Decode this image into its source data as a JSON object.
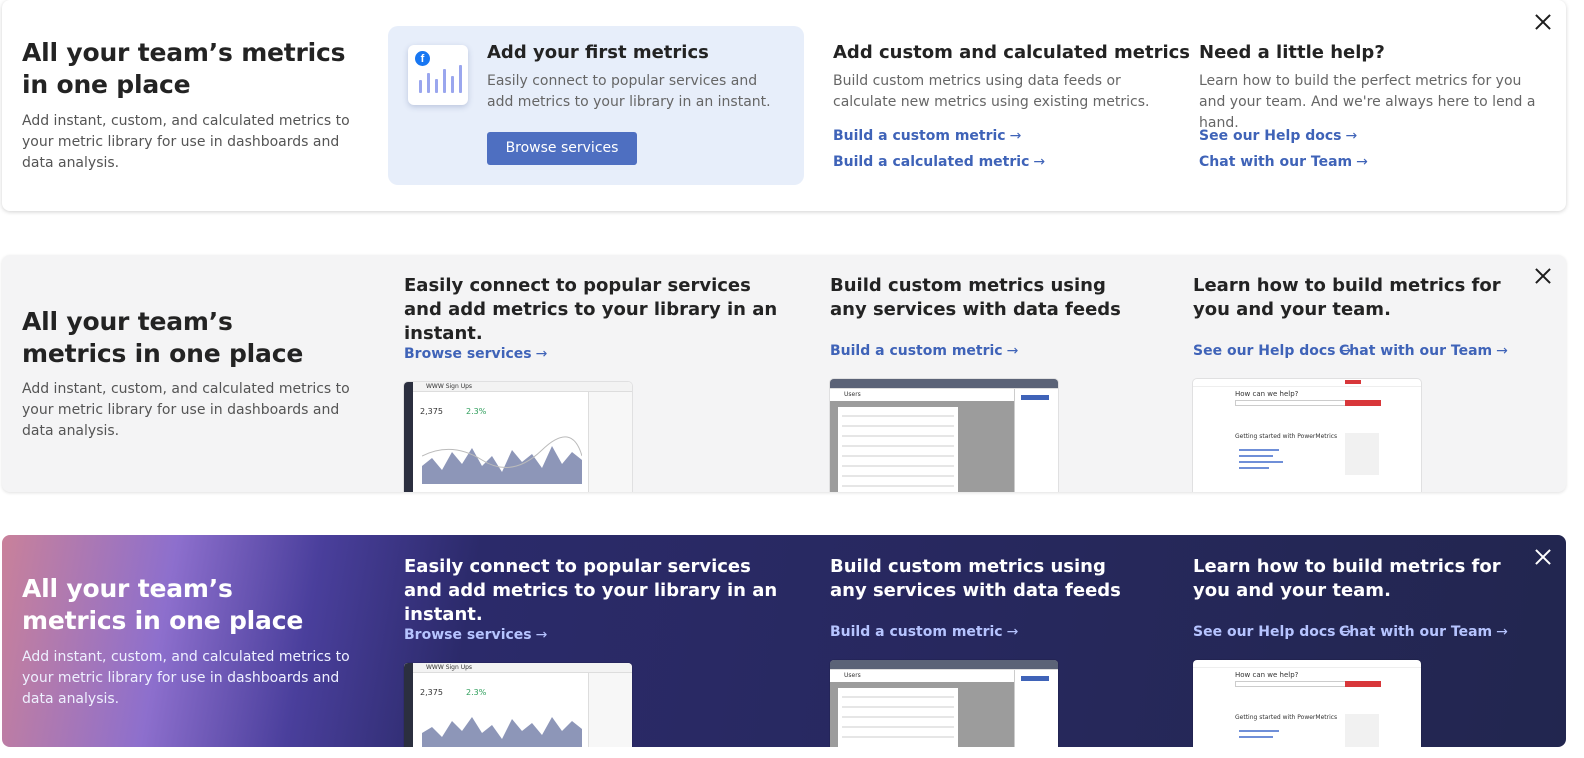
{
  "banner1": {
    "intro_title": "All your team’s metrics in one place",
    "intro_text": "Add instant, custom, and calculated metrics to your metric library for use in dashboards and data analysis.",
    "feature_title": "Add your first metrics",
    "feature_text": "Easily connect to popular services and add metrics to your library in an instant.",
    "feature_button": "Browse services",
    "custom_title": "Add custom and calculated metrics",
    "custom_text": "Build custom metrics using data feeds or calculate new metrics using existing metrics.",
    "custom_link1": "Build a custom metric",
    "custom_link2": "Build a calculated metric",
    "help_title": "Need a little help?",
    "help_text": "Learn how to build the perfect metrics for you and your team. And we're always here to lend a hand.",
    "help_link1": "See our Help docs",
    "help_link2": "Chat with our Team"
  },
  "banner2": {
    "intro_title": "All your team’s metrics in one place",
    "intro_text": "Add instant, custom, and calculated metrics to your metric library for use in dashboards and data analysis.",
    "col1_title": "Easily connect to popular services and add metrics to your library in an instant.",
    "col1_link": "Browse services",
    "col2_title": "Build custom metrics using any services with data feeds",
    "col2_link": "Build a custom metric",
    "col3_title": "Learn how to build metrics for you and your team.",
    "col3_link1": "See our Help docs",
    "col3_link2": "Chat with our Team"
  },
  "banner3": {
    "intro_title": "All your team’s metrics in one place",
    "intro_text": "Add instant, custom, and calculated metrics to your metric library for use in dashboards and data analysis.",
    "col1_title": "Easily connect to popular services and add metrics to your library in an instant.",
    "col1_link": "Browse services",
    "col2_title": "Build custom metrics using any services with data feeds",
    "col2_link": "Build a custom metric",
    "col3_title": "Learn how to build metrics for you and your team.",
    "col3_link1": "See our Help docs",
    "col3_link2": "Chat with our Team"
  },
  "thumbs": {
    "dashboard_title": "WWW Sign Ups",
    "dashboard_value": "2,375",
    "dashboard_change": "2.3%",
    "table_title": "Users",
    "help_heading": "How can we help?",
    "help_article": "Getting started with PowerMetrics"
  },
  "icons": {
    "close": "close-icon",
    "arrow": "→",
    "facebook": "facebook-icon"
  },
  "colors": {
    "link": "#3f63b8",
    "button": "#4e6fc1",
    "feature_bg": "#e7eefa",
    "dark_bg": "#22264f"
  }
}
